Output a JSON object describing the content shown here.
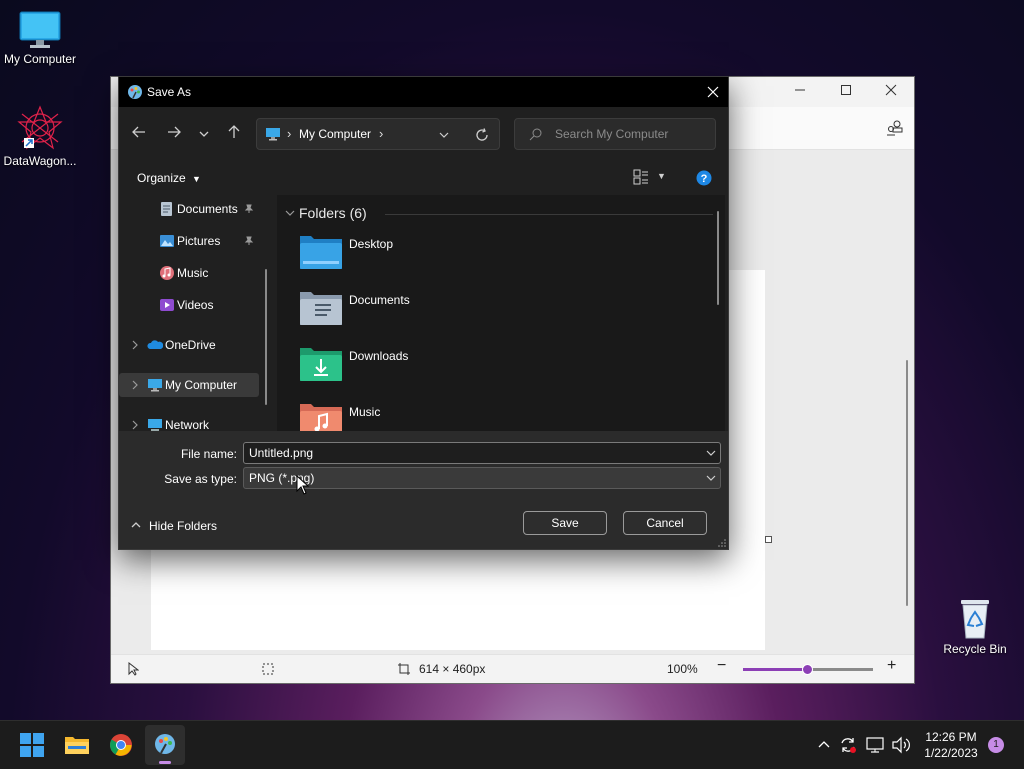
{
  "desktop": {
    "icons": [
      {
        "label": "My Computer",
        "icon": "monitor-icon"
      },
      {
        "label": "DataWagon...",
        "icon": "app-shortcut-icon"
      },
      {
        "label": "Recycle Bin",
        "icon": "recycle-bin-icon"
      }
    ]
  },
  "paint": {
    "status": {
      "canvas_size": "614 × 460px",
      "zoom": "100%",
      "zoom_level": 0.5
    }
  },
  "dialog": {
    "title": "Save As",
    "address": {
      "crumb": "My Computer",
      "separator": "›"
    },
    "search_placeholder": "Search My Computer",
    "organize_label": "Organize",
    "sidebar": [
      {
        "label": "Documents",
        "icon": "documents-icon",
        "pinned": true
      },
      {
        "label": "Pictures",
        "icon": "pictures-icon",
        "pinned": true
      },
      {
        "label": "Music",
        "icon": "music-icon"
      },
      {
        "label": "Videos",
        "icon": "videos-icon"
      },
      {
        "label": "OneDrive",
        "icon": "onedrive-icon"
      },
      {
        "label": "My Computer",
        "icon": "monitor-icon",
        "selected": true
      },
      {
        "label": "Network",
        "icon": "network-icon"
      }
    ],
    "group_header": "Folders (6)",
    "folders": [
      {
        "name": "Desktop",
        "icon": "desktop-folder-icon"
      },
      {
        "name": "Documents",
        "icon": "documents-folder-icon"
      },
      {
        "name": "Downloads",
        "icon": "downloads-folder-icon"
      },
      {
        "name": "Music",
        "icon": "music-folder-icon"
      }
    ],
    "file_name_label": "File name:",
    "file_name_value": "Untitled.png",
    "save_type_label": "Save as type:",
    "save_type_value": "PNG (*.png)",
    "hide_folders_label": "Hide Folders",
    "save_label": "Save",
    "cancel_label": "Cancel"
  },
  "taskbar": {
    "time": "12:26 PM",
    "date": "1/22/2023",
    "notification_count": "1"
  },
  "colors": {
    "accent": "#4cc2ff",
    "dialog_bg": "#202020",
    "paint_accent": "#8c3fb5"
  }
}
